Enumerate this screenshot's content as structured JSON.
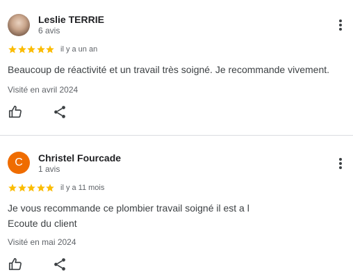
{
  "colors": {
    "star": "#fbbc04",
    "avatar_letter_bg": "#ef6c00",
    "divider": "#dadce0",
    "secondary_text": "#5f6368"
  },
  "reviews": [
    {
      "author": "Leslie TERRIE",
      "review_count": "6 avis",
      "avatar_icon": "user-photo",
      "rating": 5,
      "date": "il y a un an",
      "text": "Beaucoup de réactivité et un travail très soigné. Je recommande vivement.",
      "visited": "Visité en avril 2024"
    },
    {
      "author": "Christel Fourcade",
      "review_count": "1 avis",
      "avatar_letter": "C",
      "rating": 5,
      "date": "il y a 11 mois",
      "text_lines": [
        "Je vous recommande ce plombier travail soigné il est a l",
        "Ecoute du client"
      ],
      "visited": "Visité en mai 2024"
    }
  ],
  "icons": {
    "more": "more-vert-icon",
    "like": "thumb-up-icon",
    "share": "share-icon",
    "star": "star-icon"
  }
}
